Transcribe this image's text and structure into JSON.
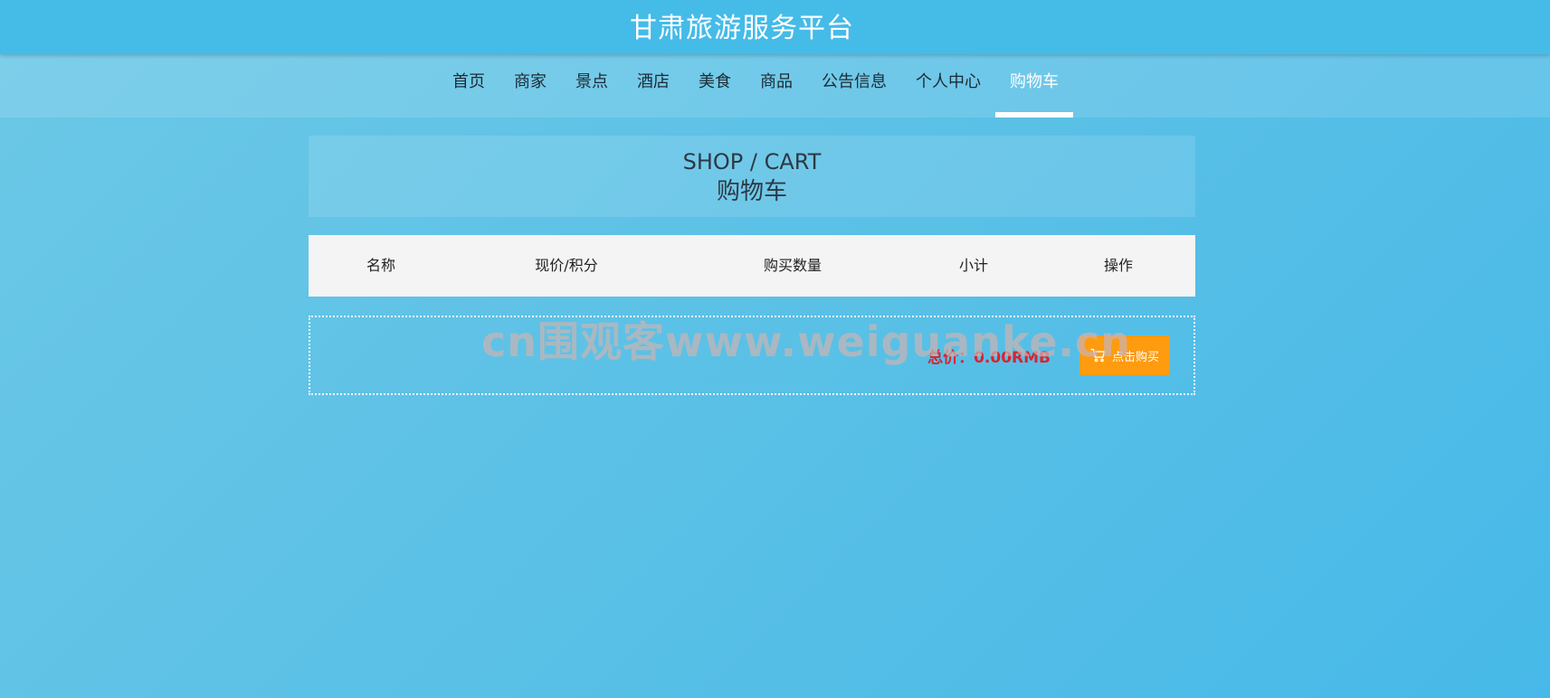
{
  "header": {
    "title": "甘肃旅游服务平台"
  },
  "nav": {
    "items": [
      {
        "label": "首页"
      },
      {
        "label": "商家"
      },
      {
        "label": "景点"
      },
      {
        "label": "酒店"
      },
      {
        "label": "美食"
      },
      {
        "label": "商品"
      },
      {
        "label": "公告信息"
      },
      {
        "label": "个人中心"
      },
      {
        "label": "购物车"
      }
    ],
    "active": "购物车"
  },
  "section": {
    "title_en": "SHOP / CART",
    "title_zh": "购物车"
  },
  "table": {
    "headers": [
      "名称",
      "现价/积分",
      "购买数量",
      "小计",
      "操作"
    ]
  },
  "footer": {
    "total_text": "总价：0.00RMB",
    "buy_label": "点击购买"
  },
  "watermark": {
    "text": "cn围观客www.weiguanke.cn"
  },
  "colors": {
    "header_bg": "#45bbe8",
    "page_bg": "#5cc1e6",
    "accent": "#ff9b0f",
    "price": "#d9232d"
  },
  "icons": {
    "buy": "shopping-cart-icon"
  }
}
